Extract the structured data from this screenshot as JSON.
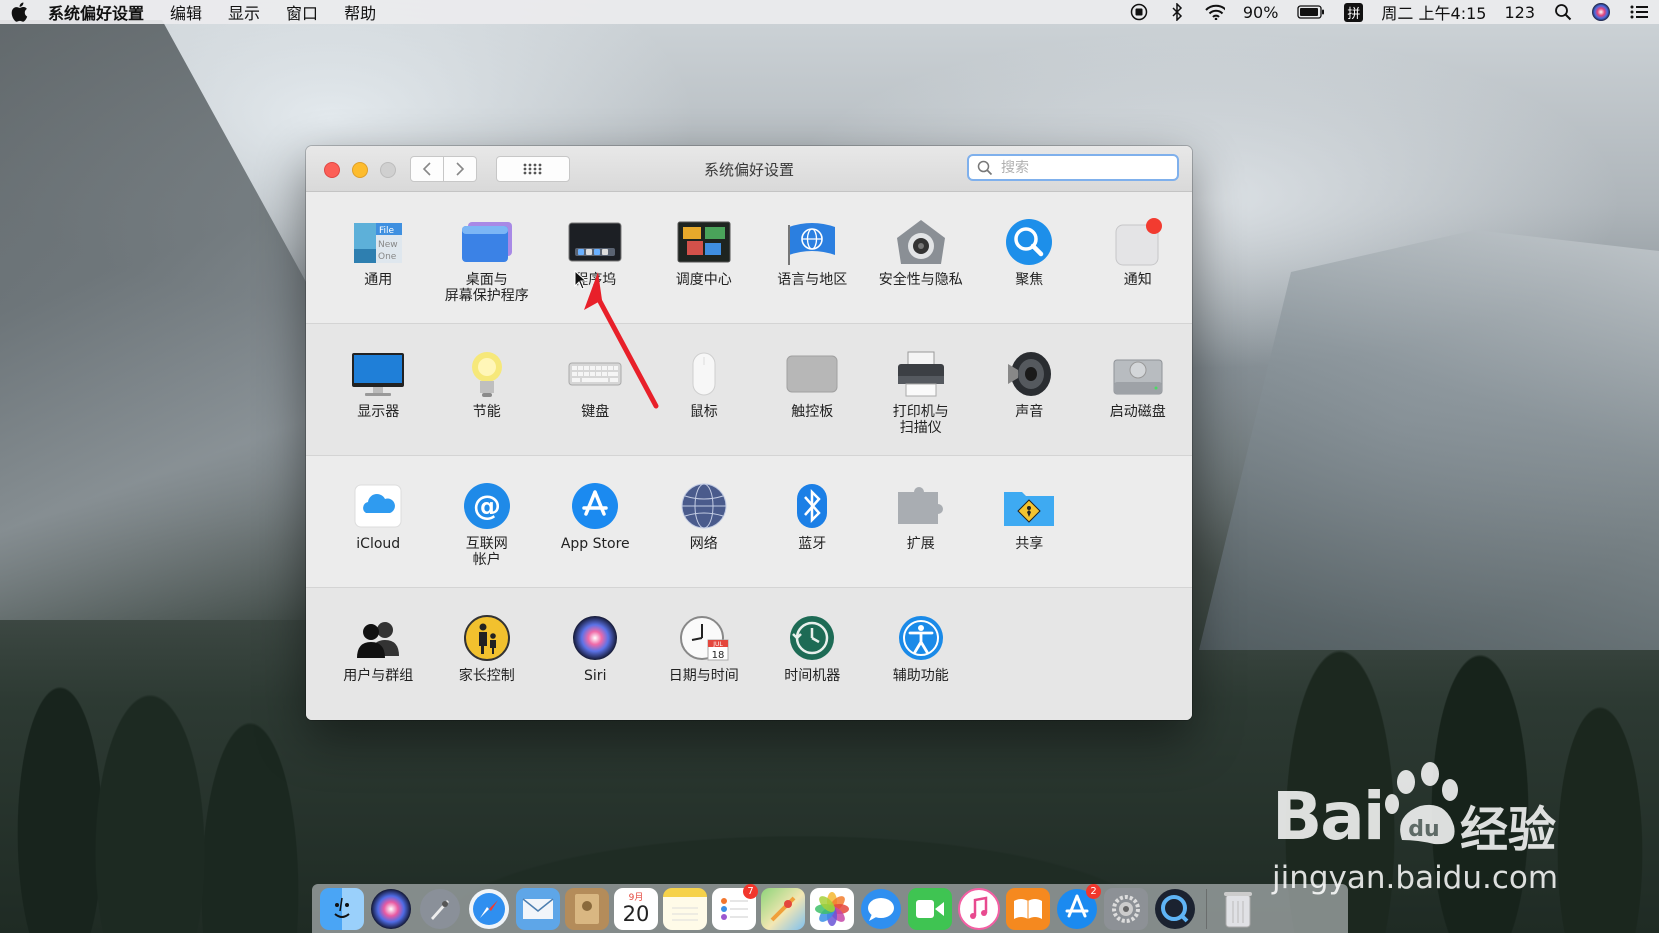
{
  "menubar": {
    "app_name": "系统偏好设置",
    "menus": [
      "编辑",
      "显示",
      "窗口",
      "帮助"
    ],
    "battery": "90%",
    "clock": "周二 上午4:15",
    "input_label": "123",
    "ime_label": "拼"
  },
  "window": {
    "title": "系统偏好设置",
    "search_placeholder": "搜索"
  },
  "panes": {
    "row1": [
      {
        "id": "general",
        "label": "通用",
        "icon": "general-icon",
        "file_lines": [
          "File",
          "New",
          "One"
        ]
      },
      {
        "id": "desktop",
        "label": "桌面与\n屏幕保护程序",
        "icon": "desktop-screensaver-icon"
      },
      {
        "id": "dock",
        "label": "程序坞",
        "icon": "dock-icon"
      },
      {
        "id": "mission",
        "label": "调度中心",
        "icon": "mission-control-icon"
      },
      {
        "id": "language",
        "label": "语言与地区",
        "icon": "language-region-icon"
      },
      {
        "id": "security",
        "label": "安全性与隐私",
        "icon": "security-privacy-icon"
      },
      {
        "id": "spotlight",
        "label": "聚焦",
        "icon": "spotlight-icon"
      },
      {
        "id": "notifications",
        "label": "通知",
        "icon": "notifications-icon"
      }
    ],
    "row2": [
      {
        "id": "displays",
        "label": "显示器",
        "icon": "display-icon"
      },
      {
        "id": "energy",
        "label": "节能",
        "icon": "energy-saver-icon"
      },
      {
        "id": "keyboard",
        "label": "键盘",
        "icon": "keyboard-icon"
      },
      {
        "id": "mouse",
        "label": "鼠标",
        "icon": "mouse-icon"
      },
      {
        "id": "trackpad",
        "label": "触控板",
        "icon": "trackpad-icon"
      },
      {
        "id": "printers",
        "label": "打印机与\n扫描仪",
        "icon": "printer-icon"
      },
      {
        "id": "sound",
        "label": "声音",
        "icon": "sound-icon"
      },
      {
        "id": "startup",
        "label": "启动磁盘",
        "icon": "startup-disk-icon"
      }
    ],
    "row3": [
      {
        "id": "icloud",
        "label": "iCloud",
        "icon": "icloud-icon"
      },
      {
        "id": "internet",
        "label": "互联网\n帐户",
        "icon": "internet-accounts-icon"
      },
      {
        "id": "appstore",
        "label": "App Store",
        "icon": "app-store-icon"
      },
      {
        "id": "network",
        "label": "网络",
        "icon": "network-icon"
      },
      {
        "id": "bluetooth",
        "label": "蓝牙",
        "icon": "bluetooth-icon"
      },
      {
        "id": "extensions",
        "label": "扩展",
        "icon": "extensions-icon"
      },
      {
        "id": "sharing",
        "label": "共享",
        "icon": "sharing-icon"
      }
    ],
    "row4": [
      {
        "id": "users",
        "label": "用户与群组",
        "icon": "users-groups-icon"
      },
      {
        "id": "parental",
        "label": "家长控制",
        "icon": "parental-controls-icon"
      },
      {
        "id": "siri",
        "label": "Siri",
        "icon": "siri-icon"
      },
      {
        "id": "datetime",
        "label": "日期与时间",
        "icon": "date-time-icon",
        "cal_month": "JUL",
        "cal_day": "18"
      },
      {
        "id": "timemachine",
        "label": "时间机器",
        "icon": "time-machine-icon"
      },
      {
        "id": "accessibility",
        "label": "辅助功能",
        "icon": "accessibility-icon"
      }
    ]
  },
  "dock": {
    "items": [
      {
        "name": "finder-icon"
      },
      {
        "name": "siri-icon"
      },
      {
        "name": "launchpad-icon"
      },
      {
        "name": "safari-icon"
      },
      {
        "name": "mail-icon"
      },
      {
        "name": "contacts-icon"
      },
      {
        "name": "calendar-icon",
        "month": "9月",
        "day": "20"
      },
      {
        "name": "notes-icon"
      },
      {
        "name": "reminders-icon",
        "badge": "7"
      },
      {
        "name": "maps-icon"
      },
      {
        "name": "photos-icon"
      },
      {
        "name": "messages-icon"
      },
      {
        "name": "facetime-icon"
      },
      {
        "name": "itunes-icon"
      },
      {
        "name": "ibooks-icon"
      },
      {
        "name": "app-store-icon",
        "badge": "2"
      },
      {
        "name": "system-preferences-icon"
      },
      {
        "name": "quicktime-icon"
      }
    ],
    "trash": {
      "name": "trash-icon"
    }
  },
  "watermark": {
    "brand": "Bai",
    "brand_cn": "经验",
    "url": "jingyan.baidu.com"
  },
  "colors": {
    "close": "#fc5f57",
    "minimize": "#fdbc2e",
    "annotation_arrow": "#e8202a",
    "search_focus": "#7fb0ec"
  }
}
